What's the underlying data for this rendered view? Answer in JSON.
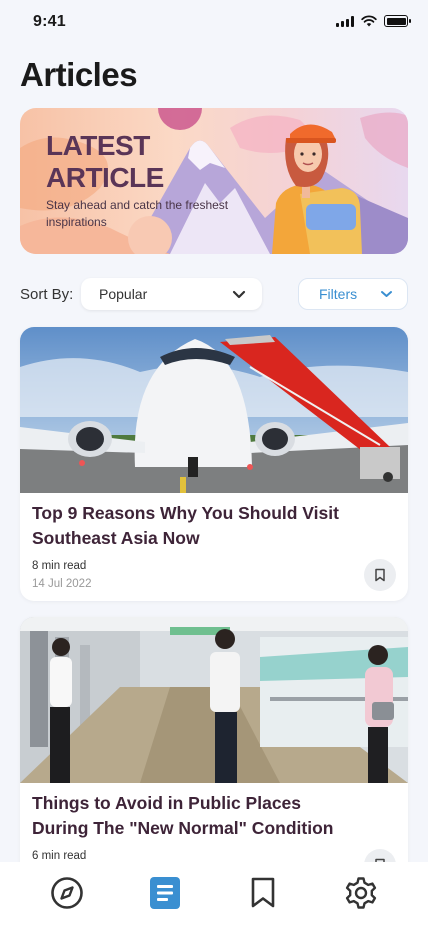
{
  "status_bar": {
    "time": "9:41"
  },
  "page": {
    "title": "Articles"
  },
  "banner": {
    "title_line1": "LATEST",
    "title_line2": "ARTICLE",
    "subtitle": "Stay ahead and catch the freshest inspirations"
  },
  "sort": {
    "label": "Sort By:",
    "selected": "Popular"
  },
  "filters": {
    "label": "Filters"
  },
  "articles": [
    {
      "title": "Top 9 Reasons Why You Should Visit Southeast Asia Now",
      "read_time": "8 min read",
      "date": "14 Jul 2022",
      "image": "airplane-boarding-photo"
    },
    {
      "title": "Things to Avoid in Public Places During The \"New Normal\" Condition",
      "read_time": "6 min read",
      "date": "",
      "image": "metro-platform-photo"
    }
  ],
  "nav": {
    "items": [
      {
        "icon": "compass-icon",
        "active": false
      },
      {
        "icon": "articles-icon",
        "active": true
      },
      {
        "icon": "bookmark-icon",
        "active": false
      },
      {
        "icon": "settings-icon",
        "active": false
      }
    ]
  },
  "colors": {
    "accent": "#3a8fd1",
    "banner_title": "#5a3557",
    "card_title": "#3e2438"
  }
}
